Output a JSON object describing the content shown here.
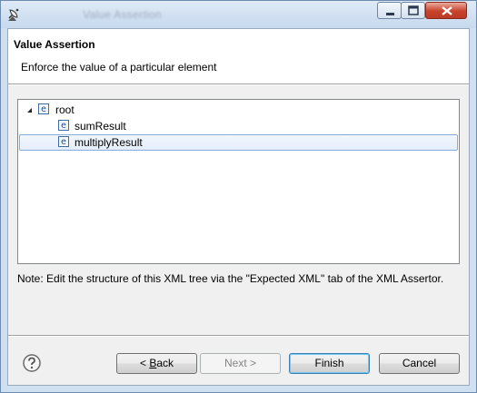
{
  "window": {
    "title": "Value Assertion"
  },
  "header": {
    "title": "Value Assertion",
    "description": "Enforce the value of a particular element"
  },
  "tree": {
    "root": {
      "icon_text": "e",
      "label": "root",
      "expanded": true
    },
    "children": [
      {
        "icon_text": "e",
        "label": "sumResult",
        "selected": false
      },
      {
        "icon_text": "e",
        "label": "multiplyResult",
        "selected": true
      }
    ]
  },
  "note": "Note: Edit the structure of this XML tree via the \"Expected XML\" tab of the XML Assertor.",
  "buttons": {
    "back_prefix": "< ",
    "back_mnemonic": "B",
    "back_rest": "ack",
    "next": "Next >",
    "finish": "Finish",
    "cancel": "Cancel"
  },
  "icons": {
    "app": "satellite-dish-icon",
    "help": "help-question-icon",
    "tree_element": "xml-element-icon"
  },
  "colors": {
    "selection_border": "#84acdd",
    "default_button_border": "#3c7fb1",
    "close_button": "#c8432c"
  }
}
